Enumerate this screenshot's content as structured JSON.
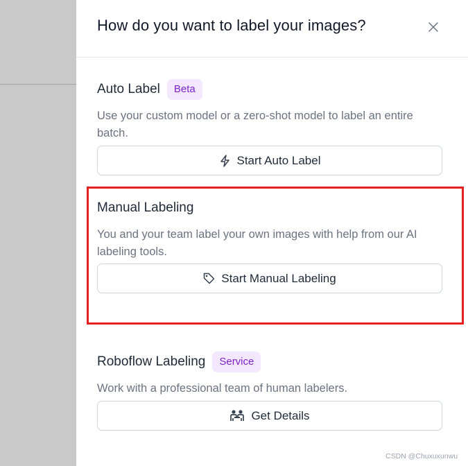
{
  "dialog": {
    "title": "How do you want to label your images?"
  },
  "sections": {
    "auto": {
      "title": "Auto Label",
      "badge": "Beta",
      "description": "Use your custom model or a zero-shot model to label an entire batch.",
      "button_label": "Start Auto Label",
      "button_icon": "lightning-icon"
    },
    "manual": {
      "title": "Manual Labeling",
      "description": "You and your team label your own images with help from our AI labeling tools.",
      "button_label": "Start Manual Labeling",
      "button_icon": "tag-icon"
    },
    "roboflow": {
      "title": "Roboflow Labeling",
      "badge": "Service",
      "description": "Work with a professional team of human labelers.",
      "button_label": "Get Details",
      "button_icon": "team-icon"
    }
  },
  "watermark": "CSDN @Chuxuxunwu",
  "colors": {
    "badge_bg": "#f3e8ff",
    "badge_text": "#7e22ce",
    "highlight": "#e5201f",
    "backdrop": "#c9c9c9"
  }
}
